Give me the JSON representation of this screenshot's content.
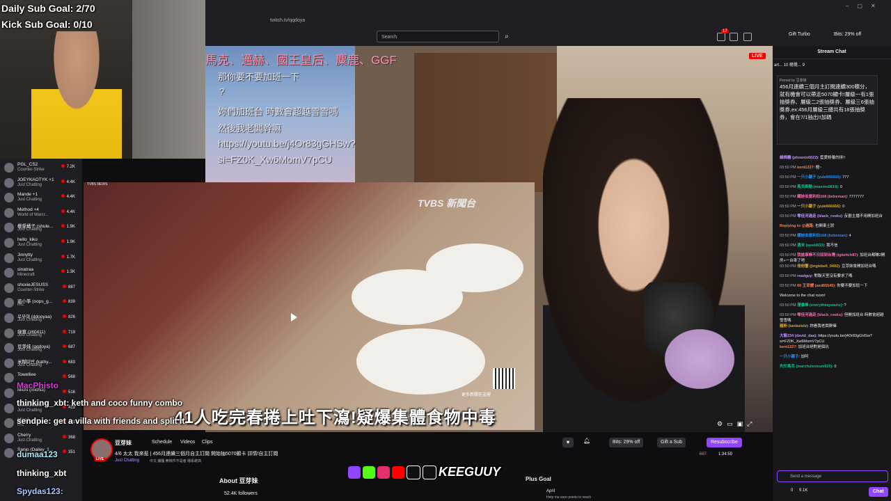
{
  "browser": {
    "url": "twitch.tv/qqdoya",
    "search_placeholder": "Search",
    "gift_turbo": "Gift Turbo",
    "bits_promo": "Bits: 29% off",
    "notif_count": "17"
  },
  "overlay": {
    "daily_sub_goal": "Daily Sub Goal: 2/70",
    "kick_sub_goal": "Kick Sub Goal: 0/10"
  },
  "sidebar": {
    "channels": [
      {
        "name": "PGL_CS2",
        "game": "Counter-Strike",
        "viewers": "7.2K"
      },
      {
        "name": "JOEYKAOTYK +1",
        "game": "Just Chatting",
        "viewers": "4.4K"
      },
      {
        "name": "Mande +1",
        "game": "Just Chatting",
        "viewers": "4.4K"
      },
      {
        "name": "Method +4",
        "game": "World of Warcr...",
        "viewers": "4.4K"
      },
      {
        "name": "櫻愛橘子 (shute...",
        "game": "Just Chatting",
        "viewers": "1.9K"
      },
      {
        "name": "hello_kiko",
        "game": "Just Chatting",
        "viewers": "1.9K"
      },
      {
        "name": "Jinnytty",
        "game": "Just Chatting",
        "viewers": "1.7K"
      },
      {
        "name": "sinatraa",
        "game": "Minecraft",
        "viewers": "1.3K"
      },
      {
        "name": "shoxieJESUSS",
        "game": "Counter-Strike",
        "viewers": "887"
      },
      {
        "name": "遊小筝 (oops_g...",
        "game": "IRL",
        "viewers": "839"
      },
      {
        "name": "로부야 (ddooyaa)",
        "game": "Just Chatting",
        "viewers": "826"
      },
      {
        "name": "綠寶 (z60411)",
        "game": "Just Chatting",
        "viewers": "719"
      },
      {
        "name": "豆芽妹 (qqdoya)",
        "game": "Just Chatting",
        "viewers": "687"
      },
      {
        "name": "米糊미반 (kathy...",
        "game": "Just Chatting",
        "viewers": "683"
      },
      {
        "name": "Towelliee",
        "game": "",
        "viewers": "568"
      },
      {
        "name": "Michi (michi3)",
        "game": "",
        "viewers": "516"
      },
      {
        "name": "GeezGiselle",
        "game": "Just Chatting",
        "viewers": "419"
      },
      {
        "name": "MissJ",
        "game": "IRL",
        "viewers": "401"
      },
      {
        "name": "Cherry",
        "game": "Just Chatting",
        "viewers": "368"
      },
      {
        "name": "Sanjo (Dailey_1...",
        "game": "",
        "viewers": "351"
      }
    ]
  },
  "stream_overlay": {
    "sky_lines": [
      "那你要不要加班一下",
      "?",
      "妳們加班台 時數會超越雪雪嗎",
      "然後我老闆幹嘛",
      "https://youtu.be/j4Or83gGHSw?",
      "si=FZ0K_Xw6MomV7pCU"
    ],
    "top_names": "馬克、邁赫、國王皇后、麋鹿、GGF",
    "news_source": "TVBS NEWS",
    "news_logo": "TVBS 新聞台",
    "news_headline": "41人吃完春捲上吐下瀉!疑爆集體食物中毒",
    "news_more": "更多新聞在這裡",
    "live": "LIVE"
  },
  "kick_chat_overlay": [
    {
      "user": "MacPhisto",
      "text": ""
    },
    {
      "user": "thinking_xbt",
      "text": ": keth and coco funny combo"
    },
    {
      "user": "sendpie",
      "text": ": get a villa with friends and split it"
    },
    {
      "user": "dumaa123",
      "text": ""
    },
    {
      "user": "thinking_xbt",
      "text": ""
    },
    {
      "user": "Spydas123",
      "text": ":"
    }
  ],
  "channel": {
    "name": "豆芽妹",
    "nav": [
      "Schedule",
      "Videos",
      "Clips"
    ],
    "title": "4/6 太太 我來惹 | 456月連續三個月自主訂閱 開始抽5070顯卡 詳情!自主訂閱",
    "category": "Just Chatting",
    "tags": "中文   捕獲   無條件不是者   嗯系統高",
    "viewers": "687",
    "uptime": "1:34:59",
    "bits_btn": "Bits: 29% off",
    "gift_btn": "Gift a Sub",
    "resub_btn": "Resubscribe",
    "about": "About 豆芽妹",
    "followers": "52.4K followers",
    "brand": "KEEGUUY",
    "plus_goal": "Plus Goal",
    "plus_name": "April",
    "plus_desc": "Help me earn points to reach"
  },
  "chat": {
    "header": "Stream Chat",
    "hype": "art...  10    總覺...  9   ",
    "pinned_by": "Pinned by 豆芽妹",
    "pinned_text": "456月連續三個月主訂閱連續300積分，就有機會可以帶走5070顯卡!層級一有1張抽獎券、層級二2張抽獎券、層級三6張抽獎券,ex:456月層級三總共有18張抽獎券，會在7/1抽出!!加碼",
    "messages": [
      {
        "time": "",
        "user": "綠桃糖 (phoenix6622)",
        "text": ": 藍愛粉養的拼!!"
      },
      {
        "time": "03:50 PM",
        "user": "kent1227",
        "text": ": 檀~"
      },
      {
        "time": "03:50 PM",
        "user": "一只小蘿子 (yuki666666)",
        "text": ": 777"
      },
      {
        "time": "03:50 PM",
        "user": "馬克斯勒 (maxmo0819)",
        "text": ": 0"
      },
      {
        "time": "03:50 PM",
        "user": "鐵娃伯當利伯168 (bebeman)",
        "text": ": 7777777"
      },
      {
        "time": "03:50 PM",
        "user": "一只小蘿子 (yuki666666)",
        "text": ": 0"
      },
      {
        "time": "03:50 PM",
        "user": "零佳河過走 (black_rooks)",
        "text": ": 反觀主播不用開加班台"
      },
      {
        "time": "",
        "user": "Replying to @過路",
        "text": ": 也開東土狀"
      },
      {
        "time": "03:50 PM",
        "user": "鐵娃伯當利伯168 (bebeman)",
        "text": ": 4"
      },
      {
        "time": "03:50 PM",
        "user": "週末 (week833)",
        "text": ": 我不信"
      },
      {
        "time": "03:50 PM",
        "user": "我搶車棒不日回到台灣 (igtwitch87)",
        "text": ": 加班台都賺2開房+一台車了吧"
      },
      {
        "time": "03:50 PM",
        "user": "冊冊響 (jinglebell_0402)",
        "text": ": 豆芽妹會開加班台嗎"
      },
      {
        "time": "03:50 PM",
        "user": "readguy",
        "text": ": 對聯天室沒有要求了嗎"
      },
      {
        "time": "03:50 PM",
        "user": "60 王幸媛 (axd65545)",
        "text": ": 你要不要加班一下"
      },
      {
        "time": "",
        "user": "",
        "text": "Welcome to the chat room!"
      },
      {
        "time": "03:50 PM",
        "user": "漫書棒 (everythingstarts)",
        "text": ": ?"
      },
      {
        "time": "03:50 PM",
        "user": "零佳河過走 (black_rooks)",
        "text": ": 但開加班台 時數會超越雪雪嗎"
      },
      {
        "time": "",
        "user": "豬粉 (tanbulolz)",
        "text": ": 妳看我老闆幹嘛"
      },
      {
        "time": "",
        "user": "大飯234 (david_daa)",
        "text": ": https://youtu.be/j4Or83gGHSw?si=FZ0K_Xw6MomV7pCU"
      },
      {
        "time": "",
        "user": "kent1227",
        "text": ": 加班台絕對是個坑"
      },
      {
        "time": "",
        "user": "一只小蘿子",
        "text": ": 加呵"
      },
      {
        "time": "",
        "user": "先忙馬克 (marchuloveuni520)",
        "text": ": 0"
      }
    ],
    "input_placeholder": "Send a message",
    "points_zero": "0",
    "points": "9.1K",
    "chat_btn": "Chat"
  }
}
